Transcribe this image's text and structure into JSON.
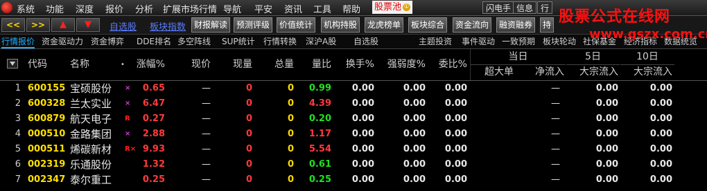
{
  "menu": {
    "items": [
      "系统",
      "功能",
      "深度",
      "报价",
      "分析",
      "扩展市场行情",
      "导航",
      "平安",
      "资讯",
      "工具",
      "帮助"
    ],
    "pool_label": "股票池",
    "pool_badge": "①",
    "right_buttons": [
      "闪电手",
      "信息",
      "行"
    ]
  },
  "toolbar": {
    "nav_buttons": [
      "<<",
      ">>",
      "▲",
      "▼"
    ],
    "links": [
      "自选股",
      "板块指数"
    ],
    "buttons": [
      "财报解读",
      "预测评级",
      "价值统计",
      "机构持股",
      "龙虎榜单",
      "板块综合",
      "资金流向",
      "融资融券",
      "持"
    ]
  },
  "watermark": {
    "title": "股票公式在线网",
    "url": "www.gszx.com.cn"
  },
  "tabs": [
    "行情报价",
    "资金驱动力",
    "资金博弈",
    "DDE排名",
    "多空阵线",
    "SUP统计",
    "行情转换",
    "深沪A股",
    "自选股",
    "主题投资",
    "事件驱动",
    "一致预期",
    "板块轮动",
    "社保基金",
    "经济指标",
    "数据统览"
  ],
  "columns": {
    "code": "代码",
    "name": "名称",
    "change_pct": "涨幅%",
    "price": "现价",
    "volume_now": "现量",
    "volume_total": "总量",
    "volume_ratio": "量比",
    "turnover": "换手%",
    "strength": "强弱度%",
    "commission_ratio": "委比%",
    "group_today": "当日",
    "group_5d": "5日",
    "group_10d": "10日",
    "super_large": "超大单",
    "net_inflow": "净流入",
    "block_inflow_5d": "大宗流入",
    "block_inflow_10d": "大宗流入"
  },
  "rows": [
    {
      "idx": "1",
      "code": "600155",
      "name": "宝硕股份",
      "flag": "×",
      "change": "0.65",
      "price": "—",
      "vol_now": "0",
      "vol_total": "0",
      "vol_ratio": "0.99",
      "turnover": "0.00",
      "strength": "0.00",
      "comm": "0.00",
      "super_large": "",
      "net": "—",
      "b5": "0.00",
      "b10": "0.00"
    },
    {
      "idx": "2",
      "code": "600328",
      "name": "兰太实业",
      "flag": "×",
      "change": "6.47",
      "price": "—",
      "vol_now": "0",
      "vol_total": "0",
      "vol_ratio": "4.39",
      "turnover": "0.00",
      "strength": "0.00",
      "comm": "0.00",
      "super_large": "",
      "net": "—",
      "b5": "0.00",
      "b10": "0.00"
    },
    {
      "idx": "3",
      "code": "600879",
      "name": "航天电子",
      "flag": "R",
      "change": "0.27",
      "price": "—",
      "vol_now": "0",
      "vol_total": "0",
      "vol_ratio": "0.20",
      "turnover": "0.00",
      "strength": "0.00",
      "comm": "0.00",
      "super_large": "",
      "net": "—",
      "b5": "0.00",
      "b10": "0.00"
    },
    {
      "idx": "4",
      "code": "000510",
      "name": "金路集团",
      "flag": "×",
      "change": "2.88",
      "price": "—",
      "vol_now": "0",
      "vol_total": "0",
      "vol_ratio": "1.17",
      "turnover": "0.00",
      "strength": "0.00",
      "comm": "0.00",
      "super_large": "",
      "net": "—",
      "b5": "0.00",
      "b10": "0.00"
    },
    {
      "idx": "5",
      "code": "000511",
      "name": "烯碳新材",
      "flag": "R×",
      "change": "9.93",
      "price": "—",
      "vol_now": "0",
      "vol_total": "0",
      "vol_ratio": "5.54",
      "turnover": "0.00",
      "strength": "0.00",
      "comm": "0.00",
      "super_large": "",
      "net": "—",
      "b5": "0.00",
      "b10": "0.00"
    },
    {
      "idx": "6",
      "code": "002319",
      "name": "乐通股份",
      "flag": "",
      "change": "1.32",
      "price": "—",
      "vol_now": "0",
      "vol_total": "0",
      "vol_ratio": "0.61",
      "turnover": "0.00",
      "strength": "0.00",
      "comm": "0.00",
      "super_large": "",
      "net": "—",
      "b5": "0.00",
      "b10": "0.00"
    },
    {
      "idx": "7",
      "code": "002347",
      "name": "泰尔重工",
      "flag": "",
      "change": "0.25",
      "price": "—",
      "vol_now": "0",
      "vol_total": "0",
      "vol_ratio": "0.25",
      "turnover": "0.00",
      "strength": "0.00",
      "comm": "0.00",
      "super_large": "",
      "net": "—",
      "b5": "0.00",
      "b10": "0.00"
    }
  ],
  "colors": {
    "up": "#ff3a3a",
    "down": "#20e020",
    "code": "#ffe000",
    "link": "#5a7cff",
    "active_tab": "#20b0ff"
  }
}
